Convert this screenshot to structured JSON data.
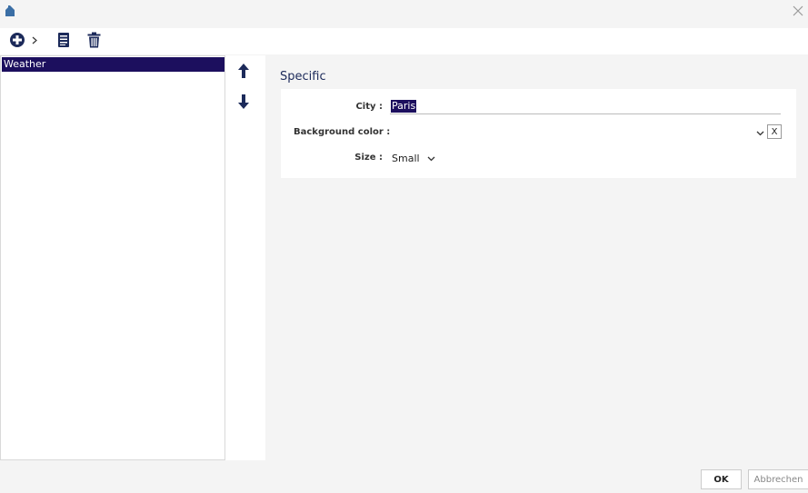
{
  "window": {
    "title_icon": "home-icon",
    "close_icon": "close-icon"
  },
  "toolbar": {
    "add_icon": "plus-circle-icon",
    "add_menu_icon": "chevron-right-icon",
    "edit_icon": "document-icon",
    "delete_icon": "trash-icon"
  },
  "list": {
    "items": [
      {
        "label": "Weather",
        "selected": true
      }
    ]
  },
  "move": {
    "up_icon": "arrow-up-icon",
    "down_icon": "arrow-down-icon"
  },
  "form": {
    "section_title": "Specific",
    "city": {
      "label": "City :",
      "value": "Paris"
    },
    "background_color": {
      "label": "Background color :",
      "value": "",
      "clear_label": "X"
    },
    "size": {
      "label": "Size :",
      "value": "Small"
    }
  },
  "footer": {
    "ok_label": "OK",
    "cancel_label": "Abbrechen"
  },
  "colors": {
    "accent": "#1c0f5e",
    "section_title": "#1c2a5a",
    "icon": "#1c2a5a"
  }
}
